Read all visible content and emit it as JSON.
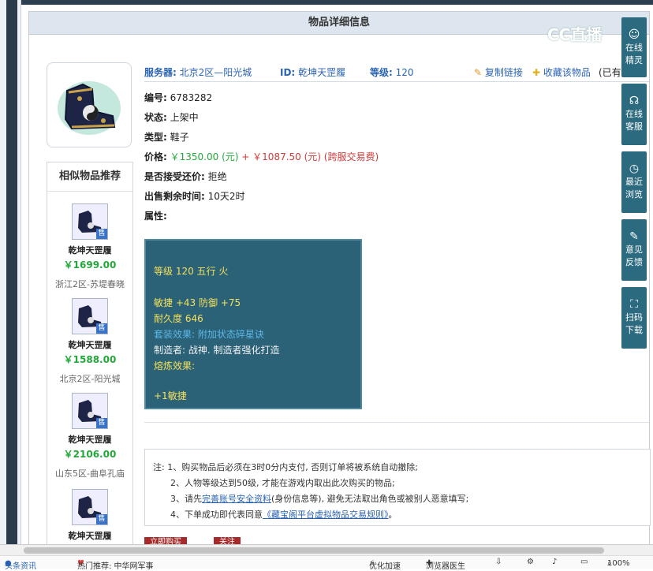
{
  "header": {
    "title": "物品详细信息"
  },
  "watermark": {
    "text": "CC直播"
  },
  "similar": {
    "title": "相似物品推荐",
    "items": [
      {
        "name": "乾坤天罡履",
        "price": "￥1699.00",
        "server": "浙江2区-苏堤春晓",
        "badge": "售"
      },
      {
        "name": "乾坤天罡履",
        "price": "￥1588.00",
        "server": "北京2区-阳光城",
        "badge": "售"
      },
      {
        "name": "乾坤天罡履",
        "price": "￥2106.00",
        "server": "山东5区-曲阜孔庙",
        "badge": "售"
      },
      {
        "name": "乾坤天罡履",
        "price": "",
        "server": "",
        "badge": "售"
      }
    ]
  },
  "detail": {
    "server_label": "服务器:",
    "server_value": "北京2区—阳光城",
    "id_label": "ID:",
    "id_value": "乾坤天罡履",
    "level_label": "等级:",
    "level_value": "120",
    "copy_link": "复制链接",
    "favorite": "收藏该物品",
    "owned_prefix": "(已有",
    "number_label": "编号:",
    "number_value": "6783282",
    "status_label": "状态:",
    "status_value": "上架中",
    "type_label": "类型:",
    "type_value": "鞋子",
    "price_label": "价格:",
    "price_value": "￥1350.00 (元)",
    "price_plus": "+",
    "price_fee": "￥1087.50 (元) (跨服交易费)",
    "bargain_label": "是否接受还价:",
    "bargain_value": "拒绝",
    "remaining_label": "出售剩余时间:",
    "remaining_value": "10天2时",
    "attr_label": "属性:"
  },
  "attributes": {
    "line1": "等级 120 五行 火",
    "line2": "敏捷 +43 防御 +75",
    "line3": "耐久度 646",
    "line4": "套装效果: 附加状态碎星诀",
    "line5": "制造者: 战神. 制造者强化打造",
    "line6": "熔炼效果:",
    "line7": "+1敏捷"
  },
  "notes": {
    "n1": "注: 1、购买物品后必须在3时0分内支付, 否则订单将被系统自动撤除;",
    "n2": "2、人物等级达到50级, 才能在游戏内取出此次购买的物品;",
    "n3_a": "3、请先",
    "n3_link": "完善账号安全资料",
    "n3_b": "(身份信息等), 避免无法取出角色或被别人恶意填写;",
    "n4_a": "4、下单成功即代表同意",
    "n4_link": "《藏宝阁平台虚拟物品交易规则》",
    "n4_b": "。"
  },
  "sidebar": [
    {
      "label1": "在线",
      "label2": "精灵",
      "icon": "sprite-icon"
    },
    {
      "label1": "在线",
      "label2": "客服",
      "icon": "headset-icon"
    },
    {
      "label1": "最近",
      "label2": "浏览",
      "icon": "clock-icon"
    },
    {
      "label1": "意见",
      "label2": "反馈",
      "icon": "edit-icon"
    },
    {
      "label1": "扫码",
      "label2": "下载",
      "icon": "scan-icon"
    }
  ],
  "status_bar": {
    "news": "头条资讯",
    "hot": "热门推荐: 中华网军事",
    "optimize": "优化加速",
    "doctor": "浏览器医生",
    "zoom": "100%"
  },
  "buttons": {
    "btn1": "立即购买",
    "btn2": "关注"
  }
}
